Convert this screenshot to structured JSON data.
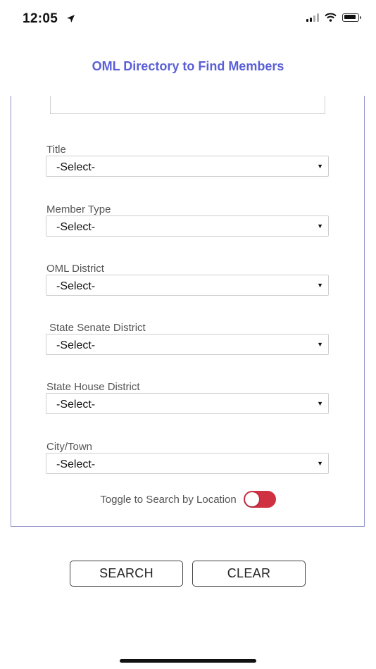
{
  "status_bar": {
    "time": "12:05",
    "icons": [
      "location-arrow-icon",
      "signal-icon",
      "wifi-icon",
      "battery-icon"
    ]
  },
  "header": {
    "title": "OML Directory to Find Members"
  },
  "form": {
    "fields": [
      {
        "label": "Title",
        "value": "-Select-"
      },
      {
        "label": "Member Type",
        "value": "-Select-"
      },
      {
        "label": "OML District",
        "value": "-Select-"
      },
      {
        "label": "State Senate District",
        "value": "-Select-"
      },
      {
        "label": "State House District",
        "value": "-Select-"
      },
      {
        "label": "City/Town",
        "value": "-Select-"
      }
    ],
    "toggle": {
      "label": "Toggle to Search by Location",
      "state": "off"
    }
  },
  "actions": {
    "search_label": "SEARCH",
    "clear_label": "CLEAR"
  },
  "colors": {
    "title": "#5a5fd6",
    "panel_border": "#8f92c9",
    "toggle_off": "#cf3042"
  }
}
